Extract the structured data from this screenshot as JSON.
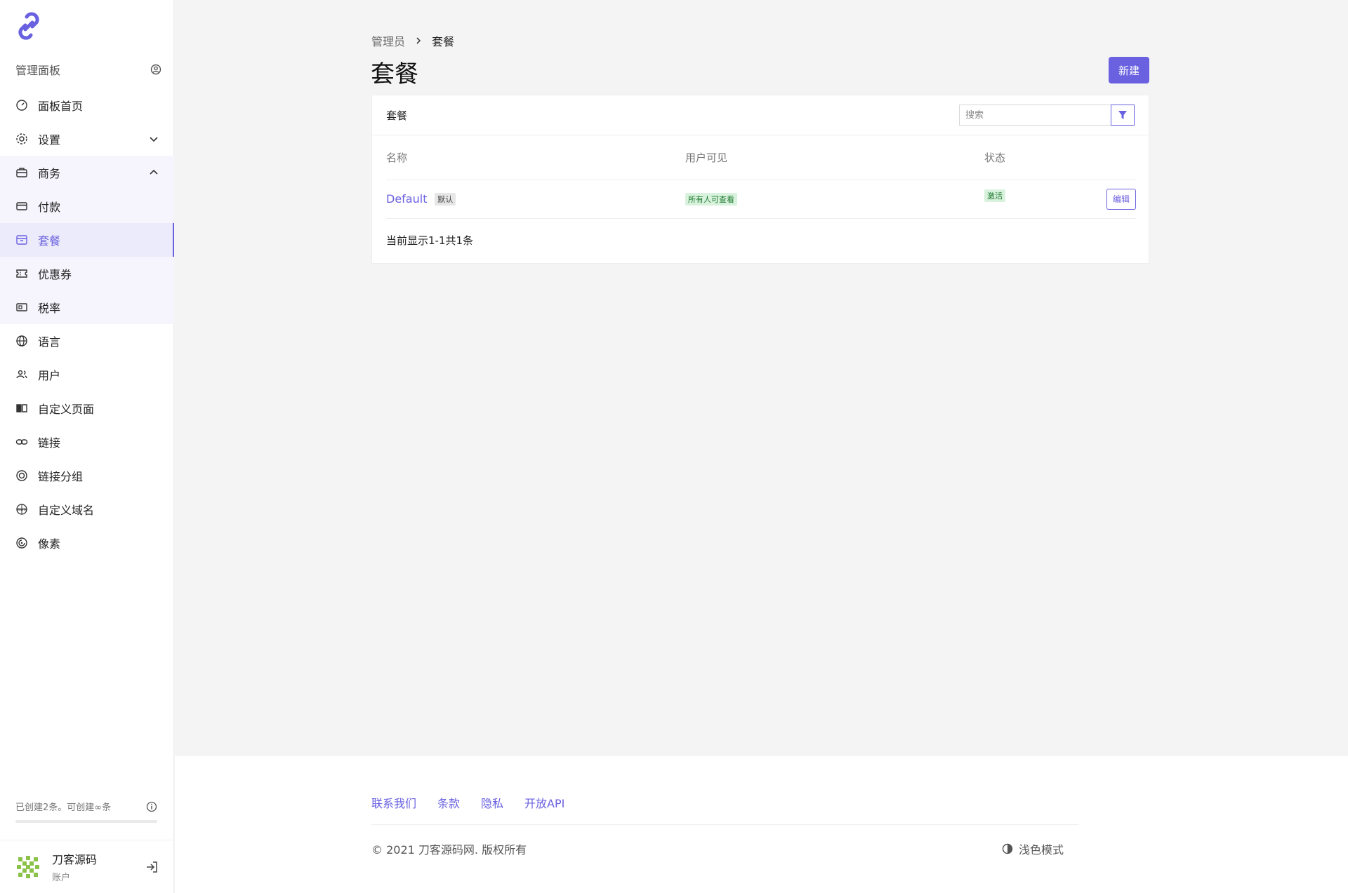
{
  "sidebar": {
    "header": "管理面板",
    "items": [
      {
        "label": "面板首页",
        "icon": "dashboard-icon"
      },
      {
        "label": "设置",
        "icon": "gear-icon"
      },
      {
        "label": "商务",
        "icon": "briefcase-icon"
      },
      {
        "label": "付款",
        "icon": "credit-card-icon"
      },
      {
        "label": "套餐",
        "icon": "package-icon"
      },
      {
        "label": "优惠券",
        "icon": "ticket-icon"
      },
      {
        "label": "税率",
        "icon": "tax-icon"
      },
      {
        "label": "语言",
        "icon": "globe-icon"
      },
      {
        "label": "用户",
        "icon": "users-icon"
      },
      {
        "label": "自定义页面",
        "icon": "book-icon"
      },
      {
        "label": "链接",
        "icon": "link-icon"
      },
      {
        "label": "链接分组",
        "icon": "target-icon"
      },
      {
        "label": "自定义域名",
        "icon": "domain-icon"
      },
      {
        "label": "像素",
        "icon": "pixel-icon"
      }
    ],
    "active_item": "套餐",
    "quota_text": "已创建2条。可创建∞条",
    "user": {
      "name": "刀客源码",
      "role": "账户"
    }
  },
  "breadcrumb": {
    "root": "管理员",
    "current": "套餐"
  },
  "page": {
    "title": "套餐",
    "new_button": "新建"
  },
  "card": {
    "title": "套餐",
    "search_placeholder": "搜索",
    "columns": [
      "名称",
      "用户可见",
      "状态"
    ],
    "rows": [
      {
        "name": "Default",
        "default_badge": "默认",
        "visibility": "所有人可查看",
        "status": "激活",
        "action": "编辑"
      }
    ],
    "pagination": "当前显示1-1共1条"
  },
  "footer": {
    "links": [
      "联系我们",
      "条款",
      "隐私",
      "开放API"
    ],
    "copyright": "© 2021 刀客源码网. 版权所有",
    "theme_toggle": "浅色模式"
  },
  "colors": {
    "accent": "#6a61e0",
    "badge_green_bg": "#d9f2dd",
    "badge_green_text": "#1f7a32"
  }
}
